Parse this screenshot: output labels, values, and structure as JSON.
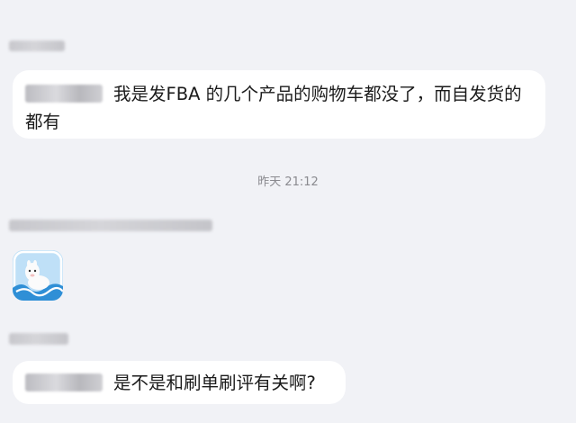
{
  "messages": [
    {
      "text": "我是发FBA 的几个产品的购物车都没了，而自发货的都有"
    },
    {
      "timestamp": "昨天 21:12"
    },
    {
      "sticker": "alpaca-sticker"
    },
    {
      "text": "是不是和刷单刷评有关啊?"
    }
  ]
}
